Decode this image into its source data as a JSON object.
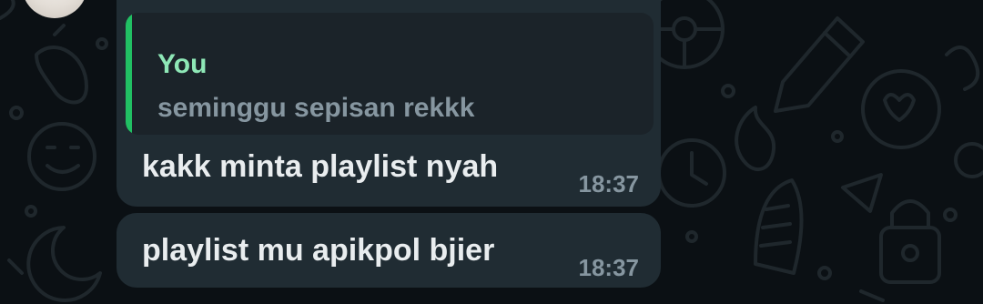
{
  "chat": {
    "background_color": "#0b1014",
    "bubble_color": "#202c33",
    "messages": [
      {
        "quote": {
          "author": "You",
          "text": "seminggu sepisan rekkk",
          "accent_color": "#21c063"
        },
        "text": "kakk minta playlist nyah",
        "time": "18:37"
      },
      {
        "text": "playlist mu apikpol bjier",
        "time": "18:37"
      }
    ]
  }
}
